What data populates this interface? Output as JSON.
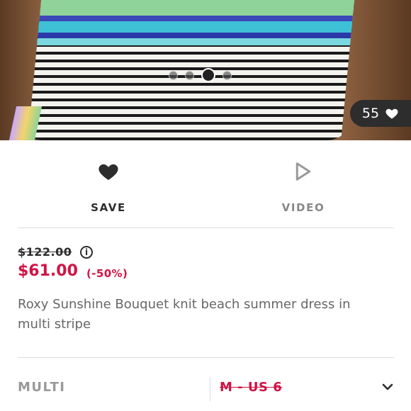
{
  "gallery": {
    "slide_count": 4,
    "active_slide_index": 2,
    "like_count": "55"
  },
  "actions": {
    "save_label": "SAVE",
    "video_label": "VIDEO"
  },
  "pricing": {
    "original_price": "$122.00",
    "sale_price": "$61.00",
    "discount": "(-50%)",
    "info_icon": "info-icon"
  },
  "product": {
    "title": "Roxy Sunshine Bouquet knit beach summer dress in multi stripe"
  },
  "variant": {
    "colour": "MULTI",
    "size": "M - US 6"
  },
  "colors": {
    "sale_red": "#d01345",
    "text_dark": "#2d2d2d",
    "text_muted": "#888888"
  }
}
